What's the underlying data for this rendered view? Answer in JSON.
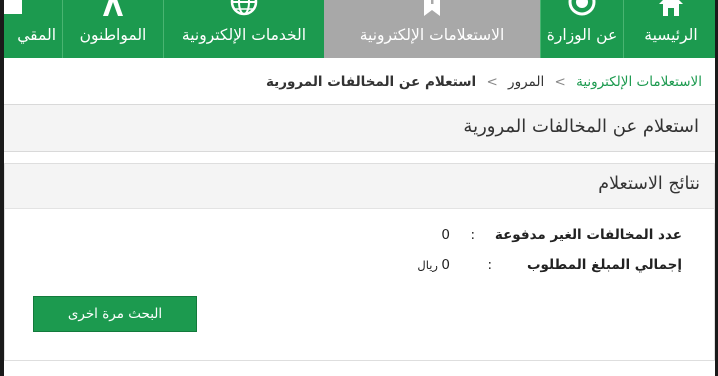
{
  "nav": {
    "items": [
      {
        "label": "الرئيسية",
        "icon": "home-icon"
      },
      {
        "label": "عن الوزارة",
        "icon": "emblem-icon"
      },
      {
        "label": "الاستعلامات الإلكترونية",
        "icon": "info-bookmark-icon",
        "active": true
      },
      {
        "label": "الخدمات الإلكترونية",
        "icon": "globe-icon"
      },
      {
        "label": "المواطنون",
        "icon": "tower-icon"
      },
      {
        "label": "المقي",
        "icon": "residents-icon"
      }
    ]
  },
  "breadcrumb": {
    "root": "الاستعلامات الإلكترونية",
    "middle": "المرور",
    "current": "استعلام عن المخالفات المرورية",
    "separator": ">"
  },
  "page": {
    "title": "استعلام عن المخالفات المرورية"
  },
  "results": {
    "title": "نتائج الاستعلام",
    "unpaid_label": "عدد المخالفات الغير مدفوعة",
    "unpaid_value": "0",
    "total_label": "إجمالي المبلغ المطلوب",
    "total_value": "0",
    "currency": "ريال",
    "colon": ":",
    "search_again": "البحث مرة اخرى"
  },
  "colors": {
    "brand": "#1c9a4f",
    "active_tab": "#a8a8a8"
  }
}
